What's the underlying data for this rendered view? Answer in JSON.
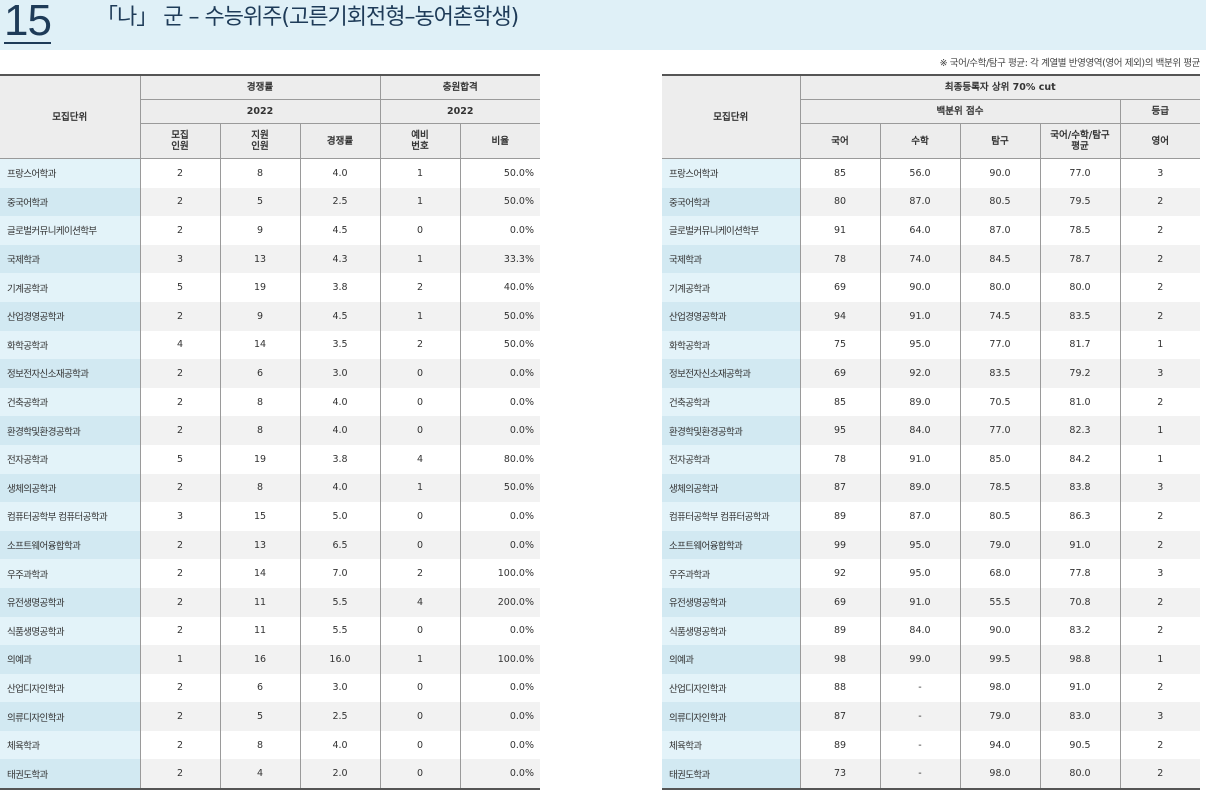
{
  "header": {
    "page_number": "15",
    "title": "「나」 군 – 수능위주(고른기회전형–농어촌학생)"
  },
  "note": "※ 국어/수학/탐구 평균: 각 계열별 반영영역(영어 제외)의 백분위 평균",
  "left_table": {
    "col_unit": "모집단위",
    "group_competition": "경쟁률",
    "group_supplement": "충원합격",
    "year_competition": "2022",
    "year_supplement": "2022",
    "col_recruit": "모집\n인원",
    "col_applicants": "지원\n인원",
    "col_ratio": "경쟁률",
    "col_waitlist": "예비\n번호",
    "col_rate": "비율",
    "rows": [
      [
        "프랑스어학과",
        "2",
        "8",
        "4.0",
        "1",
        "50.0%"
      ],
      [
        "중국어학과",
        "2",
        "5",
        "2.5",
        "1",
        "50.0%"
      ],
      [
        "글로벌커뮤니케이션학부",
        "2",
        "9",
        "4.5",
        "0",
        "0.0%"
      ],
      [
        "국제학과",
        "3",
        "13",
        "4.3",
        "1",
        "33.3%"
      ],
      [
        "기계공학과",
        "5",
        "19",
        "3.8",
        "2",
        "40.0%"
      ],
      [
        "산업경영공학과",
        "2",
        "9",
        "4.5",
        "1",
        "50.0%"
      ],
      [
        "화학공학과",
        "4",
        "14",
        "3.5",
        "2",
        "50.0%"
      ],
      [
        "정보전자신소재공학과",
        "2",
        "6",
        "3.0",
        "0",
        "0.0%"
      ],
      [
        "건축공학과",
        "2",
        "8",
        "4.0",
        "0",
        "0.0%"
      ],
      [
        "환경학및환경공학과",
        "2",
        "8",
        "4.0",
        "0",
        "0.0%"
      ],
      [
        "전자공학과",
        "5",
        "19",
        "3.8",
        "4",
        "80.0%"
      ],
      [
        "생체의공학과",
        "2",
        "8",
        "4.0",
        "1",
        "50.0%"
      ],
      [
        "컴퓨터공학부 컴퓨터공학과",
        "3",
        "15",
        "5.0",
        "0",
        "0.0%"
      ],
      [
        "소프트웨어융합학과",
        "2",
        "13",
        "6.5",
        "0",
        "0.0%"
      ],
      [
        "우주과학과",
        "2",
        "14",
        "7.0",
        "2",
        "100.0%"
      ],
      [
        "유전생명공학과",
        "2",
        "11",
        "5.5",
        "4",
        "200.0%"
      ],
      [
        "식품생명공학과",
        "2",
        "11",
        "5.5",
        "0",
        "0.0%"
      ],
      [
        "의예과",
        "1",
        "16",
        "16.0",
        "1",
        "100.0%"
      ],
      [
        "산업디자인학과",
        "2",
        "6",
        "3.0",
        "0",
        "0.0%"
      ],
      [
        "의류디자인학과",
        "2",
        "5",
        "2.5",
        "0",
        "0.0%"
      ],
      [
        "체육학과",
        "2",
        "8",
        "4.0",
        "0",
        "0.0%"
      ],
      [
        "태권도학과",
        "2",
        "4",
        "2.0",
        "0",
        "0.0%"
      ]
    ]
  },
  "right_table": {
    "col_unit": "모집단위",
    "group_final": "최종등록자 상위 70% cut",
    "group_percentile": "백분위 점수",
    "group_grade": "등급",
    "col_korean": "국어",
    "col_math": "수학",
    "col_inquiry": "탐구",
    "col_avg": "국어/수학/탐구\n평균",
    "col_english": "영어",
    "rows": [
      [
        "프랑스어학과",
        "85",
        "56.0",
        "90.0",
        "77.0",
        "3"
      ],
      [
        "중국어학과",
        "80",
        "87.0",
        "80.5",
        "79.5",
        "2"
      ],
      [
        "글로벌커뮤니케이션학부",
        "91",
        "64.0",
        "87.0",
        "78.5",
        "2"
      ],
      [
        "국제학과",
        "78",
        "74.0",
        "84.5",
        "78.7",
        "2"
      ],
      [
        "기계공학과",
        "69",
        "90.0",
        "80.0",
        "80.0",
        "2"
      ],
      [
        "산업경영공학과",
        "94",
        "91.0",
        "74.5",
        "83.5",
        "2"
      ],
      [
        "화학공학과",
        "75",
        "95.0",
        "77.0",
        "81.7",
        "1"
      ],
      [
        "정보전자신소재공학과",
        "69",
        "92.0",
        "83.5",
        "79.2",
        "3"
      ],
      [
        "건축공학과",
        "85",
        "89.0",
        "70.5",
        "81.0",
        "2"
      ],
      [
        "환경학및환경공학과",
        "95",
        "84.0",
        "77.0",
        "82.3",
        "1"
      ],
      [
        "전자공학과",
        "78",
        "91.0",
        "85.0",
        "84.2",
        "1"
      ],
      [
        "생체의공학과",
        "87",
        "89.0",
        "78.5",
        "83.8",
        "3"
      ],
      [
        "컴퓨터공학부 컴퓨터공학과",
        "89",
        "87.0",
        "80.5",
        "86.3",
        "2"
      ],
      [
        "소프트웨어융합학과",
        "99",
        "95.0",
        "79.0",
        "91.0",
        "2"
      ],
      [
        "우주과학과",
        "92",
        "95.0",
        "68.0",
        "77.8",
        "3"
      ],
      [
        "유전생명공학과",
        "69",
        "91.0",
        "55.5",
        "70.8",
        "2"
      ],
      [
        "식품생명공학과",
        "89",
        "84.0",
        "90.0",
        "83.2",
        "2"
      ],
      [
        "의예과",
        "98",
        "99.0",
        "99.5",
        "98.8",
        "1"
      ],
      [
        "산업디자인학과",
        "88",
        "-",
        "98.0",
        "91.0",
        "2"
      ],
      [
        "의류디자인학과",
        "87",
        "-",
        "79.0",
        "83.0",
        "3"
      ],
      [
        "체육학과",
        "89",
        "-",
        "94.0",
        "90.5",
        "2"
      ],
      [
        "태권도학과",
        "73",
        "-",
        "98.0",
        "80.0",
        "2"
      ]
    ]
  }
}
